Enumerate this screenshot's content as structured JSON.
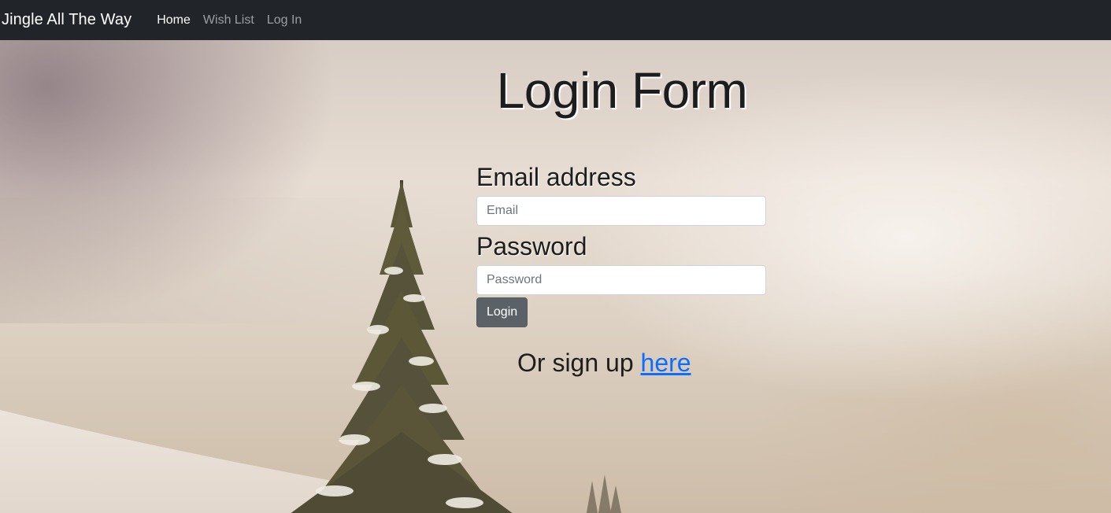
{
  "navbar": {
    "brand": "Jingle All The Way",
    "links": [
      {
        "label": "Home",
        "active": true
      },
      {
        "label": "Wish List",
        "active": false
      },
      {
        "label": "Log In",
        "active": false
      }
    ]
  },
  "main": {
    "title": "Login Form",
    "email": {
      "label": "Email address",
      "placeholder": "Email",
      "value": ""
    },
    "password": {
      "label": "Password",
      "placeholder": "Password",
      "value": ""
    },
    "login_button": "Login",
    "signup_prefix": "Or sign up ",
    "signup_link": "here"
  },
  "colors": {
    "navbar_bg": "#212529",
    "button_bg": "#5a6268",
    "link": "#0d6efd"
  }
}
